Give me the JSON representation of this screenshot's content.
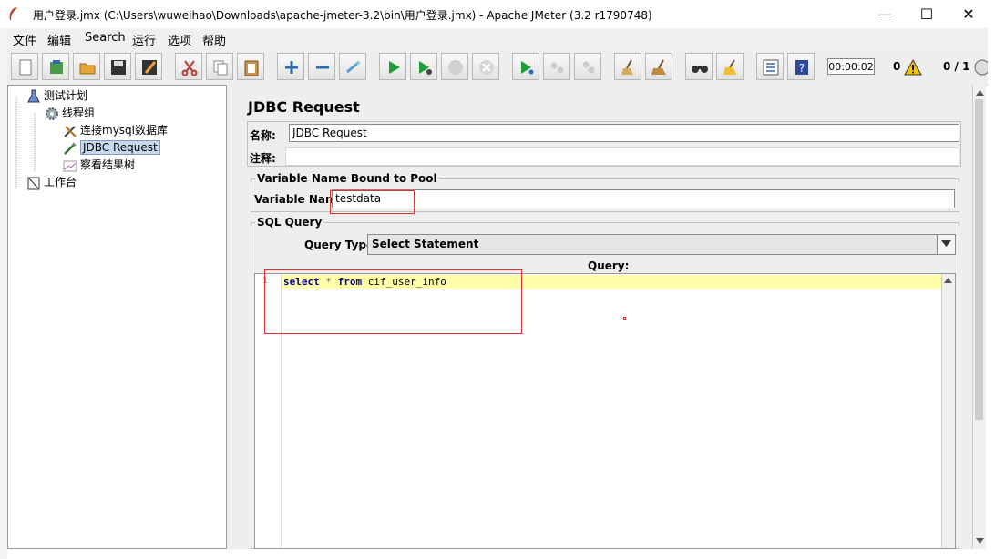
{
  "window": {
    "title": "用户登录.jmx (C:\\Users\\wuweihao\\Downloads\\apache-jmeter-3.2\\bin\\用户登录.jmx) - Apache JMeter (3.2 r1790748)",
    "minimize": "—",
    "maximize": "☐",
    "close": "✕"
  },
  "menu": [
    "文件",
    "编辑",
    "Search",
    "运行",
    "选项",
    "帮助"
  ],
  "toolbar": {
    "timer": "00:00:02",
    "error_count": "0",
    "threads": "0 / 1"
  },
  "tree": [
    {
      "label": "测试计划",
      "icon": "test-plan-icon"
    },
    {
      "label": "线程组",
      "icon": "thread-group-icon"
    },
    {
      "label": "连接mysql数据库",
      "icon": "config-tool-icon"
    },
    {
      "label": "JDBC Request",
      "icon": "sampler-icon",
      "selected": true
    },
    {
      "label": "察看结果树",
      "icon": "listener-icon"
    },
    {
      "label": "工作台",
      "icon": "workbench-icon"
    }
  ],
  "panel": {
    "title": "JDBC Request",
    "name_label": "名称:",
    "name_value": "JDBC Request",
    "comment_label": "注释:",
    "comment_value": "",
    "pool_group_title": "Variable Name Bound to Pool",
    "var_name_label": "Variable Name:",
    "var_name_value": "testdata",
    "sql_group_title": "SQL Query",
    "query_type_label": "Query Type:",
    "query_type_value": "Select Statement",
    "query_label": "Query:",
    "line_number": "1",
    "sql": {
      "kw1": "select",
      "star": " * ",
      "kw2": "from",
      "rest": " cif_user_info"
    }
  }
}
